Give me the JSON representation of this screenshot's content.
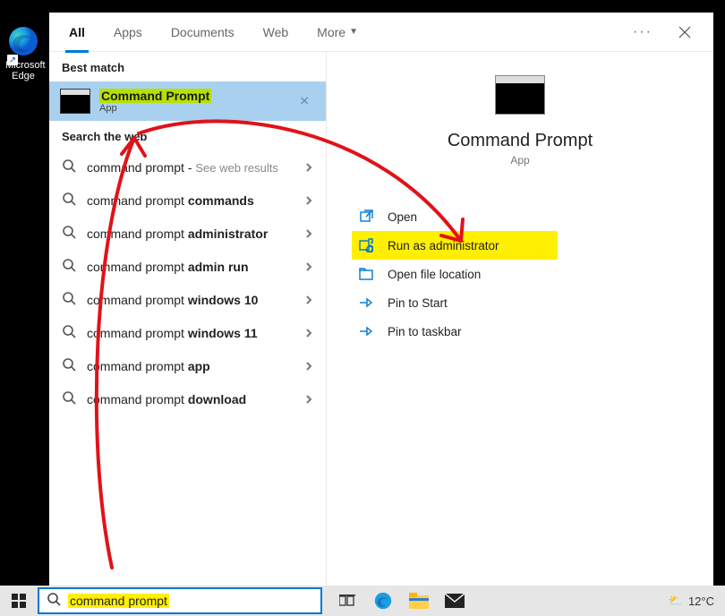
{
  "desktop": {
    "edge_label": "Microsoft Edge"
  },
  "tabs": {
    "items": [
      "All",
      "Apps",
      "Documents",
      "Web",
      "More"
    ],
    "active_index": 0
  },
  "left": {
    "best_match_header": "Best match",
    "best_match": {
      "title": "Command Prompt",
      "sub": "App"
    },
    "web_header": "Search the web",
    "web_hint": "See web results",
    "web_items": [
      {
        "prefix": "command prompt",
        "bold": "",
        "hint": true
      },
      {
        "prefix": "command prompt ",
        "bold": "commands"
      },
      {
        "prefix": "command prompt ",
        "bold": "administrator"
      },
      {
        "prefix": "command prompt ",
        "bold": "admin run"
      },
      {
        "prefix": "command prompt ",
        "bold": "windows 10"
      },
      {
        "prefix": "command prompt ",
        "bold": "windows 11"
      },
      {
        "prefix": "command prompt ",
        "bold": "app"
      },
      {
        "prefix": "command prompt ",
        "bold": "download"
      }
    ]
  },
  "right": {
    "title": "Command Prompt",
    "sub": "App",
    "actions": [
      {
        "label": "Open",
        "icon": "open"
      },
      {
        "label": "Run as administrator",
        "icon": "admin",
        "highlight": true
      },
      {
        "label": "Open file location",
        "icon": "folder"
      },
      {
        "label": "Pin to Start",
        "icon": "pin"
      },
      {
        "label": "Pin to taskbar",
        "icon": "pin"
      }
    ]
  },
  "taskbar": {
    "query": "command prompt",
    "temp": "12°C"
  }
}
